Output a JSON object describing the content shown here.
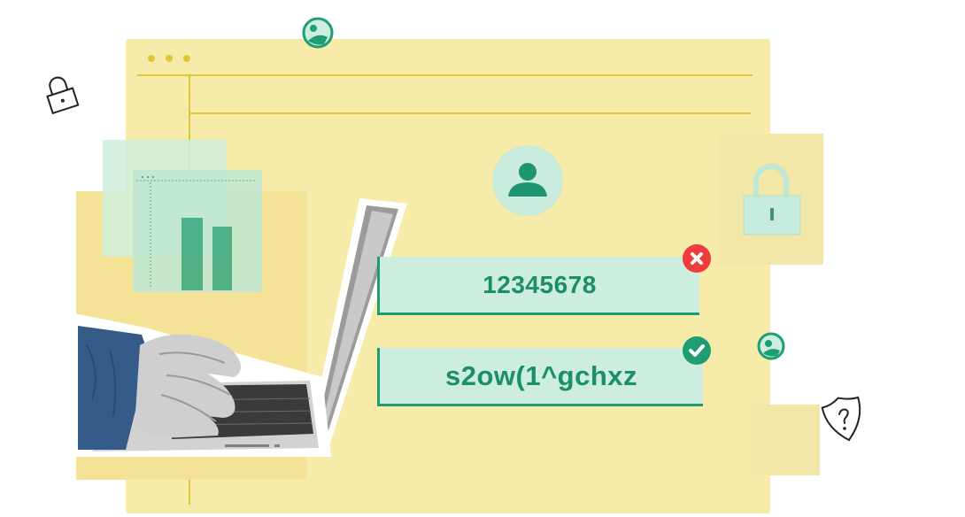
{
  "window": {
    "dots": 3
  },
  "colors": {
    "background": "#ffffff",
    "window_bg": "#f7eba9",
    "rule_lines": "#e0c53b",
    "mint": "#cdeedf",
    "accent_green": "#1e9b72",
    "error_red": "#ef3b3b"
  },
  "icons": {
    "avatar": "user-icon",
    "lock_large": "padlock-icon",
    "lock_small": "padlock-outline-icon",
    "shield": "shield-question-icon",
    "image_top": "image-icon",
    "image_right": "image-icon",
    "error": "close-icon",
    "success": "check-icon"
  },
  "password_fields": {
    "weak": {
      "value": "12345678",
      "status": "invalid"
    },
    "strong": {
      "value": "s2ow(1^gchxz",
      "status": "valid"
    }
  },
  "chart_panel": {
    "bars": 2
  }
}
